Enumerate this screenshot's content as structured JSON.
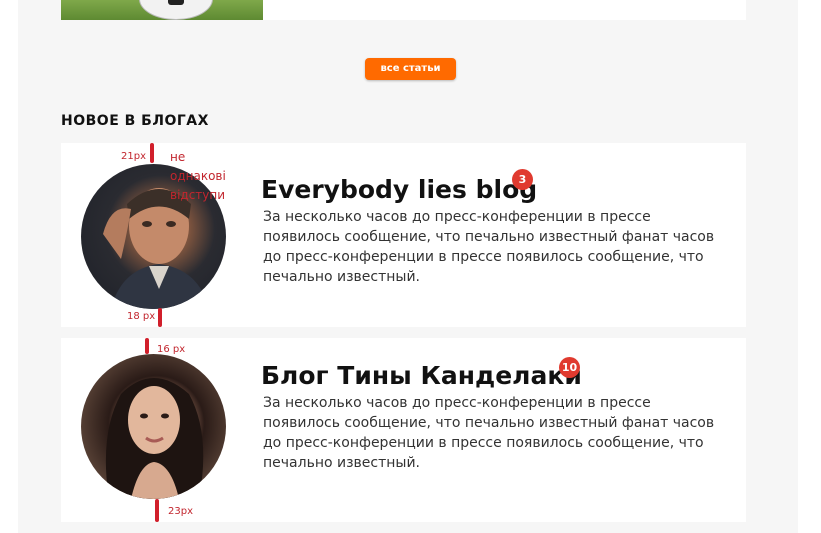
{
  "top_card": {
    "image": "soccer-ball-on-grass"
  },
  "all_articles_button": "все статьи",
  "section_title": "НОВОЕ В БЛОГАХ",
  "blogs": [
    {
      "title": "Everybody lies blog",
      "badge": "3",
      "description": "За несколько часов до пресс-конференции в прессе появилось сообщение, что печально известный фанат часов до пресс-конференции в прессе появилось сообщение, что печально известный.",
      "avatar": "man-portrait"
    },
    {
      "title": "Блог Тины Канделаки",
      "badge": "10",
      "description": "За несколько часов до пресс-конференции в прессе появилось сообщение, что печально известный фанат часов до пресс-конференции в прессе появилось сообщение, что печально известный.",
      "avatar": "woman-portrait"
    }
  ],
  "annotations": {
    "gap_top_1": "21px",
    "note": "не однакові відступи",
    "gap_bottom_1": "18 px",
    "gap_top_2": "16 px",
    "gap_bottom_2": "23px"
  },
  "colors": {
    "accent": "#ff6a00",
    "badge": "#e03a2f",
    "annotation": "#c2262e",
    "page_bg": "#f6f6f6"
  }
}
